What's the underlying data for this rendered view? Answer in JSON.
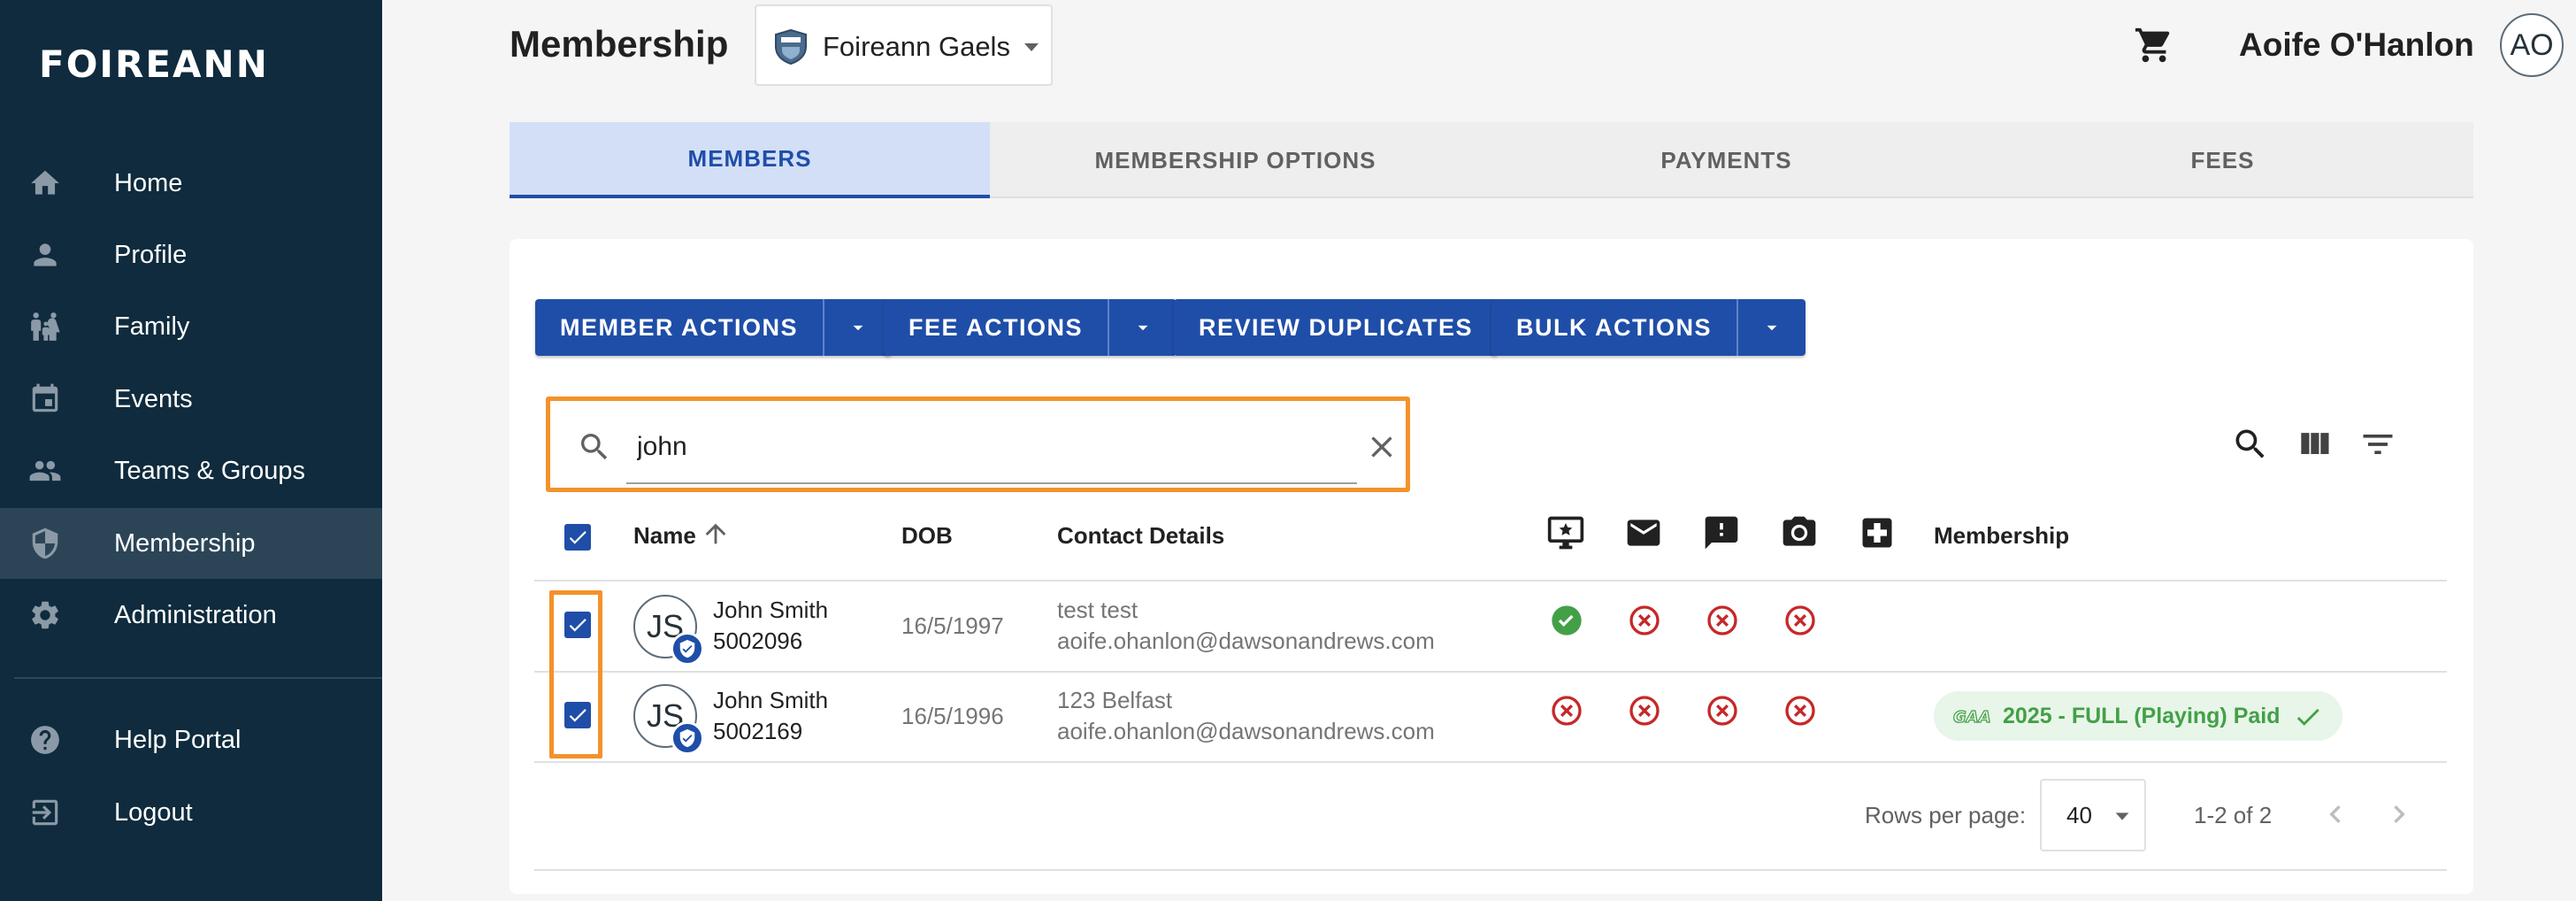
{
  "sidebar": {
    "logo": "FOIREANN",
    "items": [
      {
        "label": "Home",
        "icon": "home-icon"
      },
      {
        "label": "Profile",
        "icon": "person-icon"
      },
      {
        "label": "Family",
        "icon": "family-icon"
      },
      {
        "label": "Events",
        "icon": "calendar-icon"
      },
      {
        "label": "Teams & Groups",
        "icon": "groups-icon"
      },
      {
        "label": "Membership",
        "icon": "shield-icon",
        "active": true
      },
      {
        "label": "Administration",
        "icon": "gear-icon"
      },
      {
        "label": "Help Portal",
        "icon": "help-icon"
      },
      {
        "label": "Logout",
        "icon": "logout-icon"
      }
    ]
  },
  "header": {
    "title": "Membership",
    "club": "Foireann Gaels",
    "user_name": "Aoife O'Hanlon",
    "user_initials": "AO"
  },
  "tabs": [
    "MEMBERS",
    "MEMBERSHIP OPTIONS",
    "PAYMENTS",
    "FEES"
  ],
  "active_tab": "MEMBERS",
  "actions": {
    "member_actions": "MEMBER ACTIONS",
    "fee_actions": "FEE ACTIONS",
    "review_duplicates": "REVIEW DUPLICATES",
    "bulk_actions": "BULK ACTIONS"
  },
  "search": {
    "value": "john"
  },
  "table": {
    "columns": {
      "name": "Name",
      "dob": "DOB",
      "contact": "Contact Details",
      "membership": "Membership"
    },
    "header_icons": [
      "desktop-star-icon",
      "email-icon",
      "feedback-icon",
      "camera-icon",
      "medical-icon"
    ],
    "rows": [
      {
        "initials": "JS",
        "name": "John Smith",
        "id": "5002096",
        "dob": "16/5/1997",
        "contact_line1": "test test",
        "contact_line2": "aoife.ohanlon@dawsonandrews.com",
        "statuses": [
          "ok",
          "no",
          "no",
          "no"
        ],
        "membership": ""
      },
      {
        "initials": "JS",
        "name": "John Smith",
        "id": "5002169",
        "dob": "16/5/1996",
        "contact_line1": "123 Belfast",
        "contact_line2": "aoife.ohanlon@dawsonandrews.com",
        "statuses": [
          "no",
          "no",
          "no",
          "no"
        ],
        "membership": "2025 - FULL (Playing) Paid"
      }
    ]
  },
  "pagination": {
    "rows_per_page_label": "Rows per page:",
    "rows_per_page": "40",
    "range": "1-2 of 2"
  },
  "colors": {
    "sidebar_bg": "#0f2b3d",
    "primary": "#1f4ea8",
    "highlight": "#f3922a",
    "ok_green": "#43a047",
    "error_red": "#c62828"
  }
}
